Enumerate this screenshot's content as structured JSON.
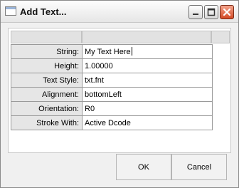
{
  "window": {
    "title": "Add Text..."
  },
  "titlebar_buttons": {
    "minimize_icon": "minimize-icon",
    "maximize_icon": "maximize-icon",
    "close_icon": "close-icon"
  },
  "properties": [
    {
      "label": "String:",
      "value": "My Text Here"
    },
    {
      "label": "Height:",
      "value": "1.00000"
    },
    {
      "label": "Text Style:",
      "value": "txt.fnt"
    },
    {
      "label": "Alignment:",
      "value": "bottomLeft"
    },
    {
      "label": "Orientation:",
      "value": "R0"
    },
    {
      "label": "Stroke With:",
      "value": "Active Dcode"
    }
  ],
  "buttons": {
    "ok": "OK",
    "cancel": "Cancel"
  },
  "colors": {
    "close_button": "#d44a25",
    "header_gray": "#e2e2e2"
  }
}
